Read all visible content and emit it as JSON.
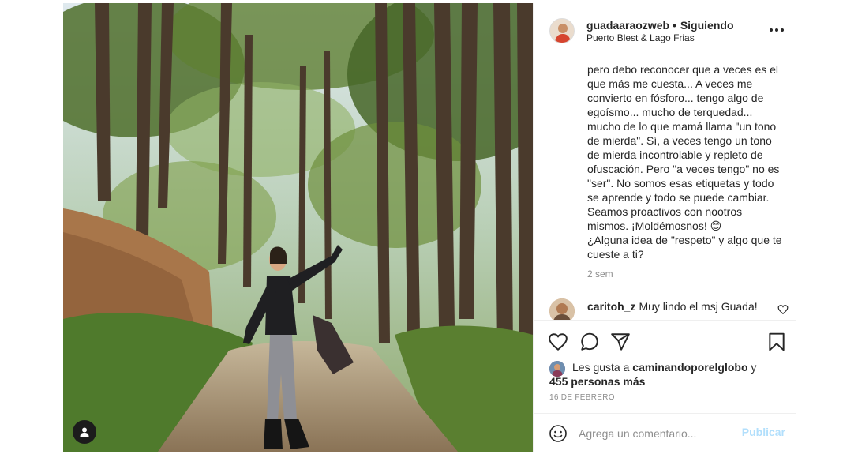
{
  "header": {
    "username": "guadaaraozweb",
    "separator": "•",
    "follow_status": "Siguiendo",
    "location": "Puerto Blest & Lago Frias"
  },
  "caption": {
    "lines": [
      "pero debo reconocer que a veces es el",
      "que más me cuesta... A veces me",
      "convierto en fósforo... tengo algo de",
      "egoísmo... mucho de terquedad...",
      "mucho de lo que mamá llama \"un tono",
      "de mierda\". Sí, a veces tengo un tono",
      "de mierda incontrolable y repleto de",
      "ofuscación. Pero \"a veces tengo\" no es",
      "\"ser\". No somos esas etiquetas y todo",
      "se aprende y todo se puede cambiar.",
      "Seamos proactivos con nootros",
      "mismos. ¡Moldémosnos! 😊",
      "¿Alguna idea de \"respeto\" y algo que te",
      "cueste a ti?"
    ],
    "time": "2 sem"
  },
  "comment": {
    "username": "caritoh_z",
    "text": "Muy lindo el msj Guada!"
  },
  "likes": {
    "prefix": "Les gusta a ",
    "user": "caminandoporelglobo",
    "suffix": " y",
    "others": "455 personas más"
  },
  "date": "16 DE FEBRERO",
  "add_comment": {
    "placeholder": "Agrega un comentario...",
    "publish": "Publicar"
  },
  "icons": {
    "more": "more-options-icon",
    "like": "heart-icon",
    "comment": "comment-icon",
    "share": "share-icon",
    "save": "bookmark-icon",
    "emoji": "emoji-icon",
    "user_tag": "user-tag-icon"
  },
  "colors": {
    "publish_disabled": "#b2dffc",
    "secondary_text": "#8e8e8e",
    "border": "#efefef"
  }
}
